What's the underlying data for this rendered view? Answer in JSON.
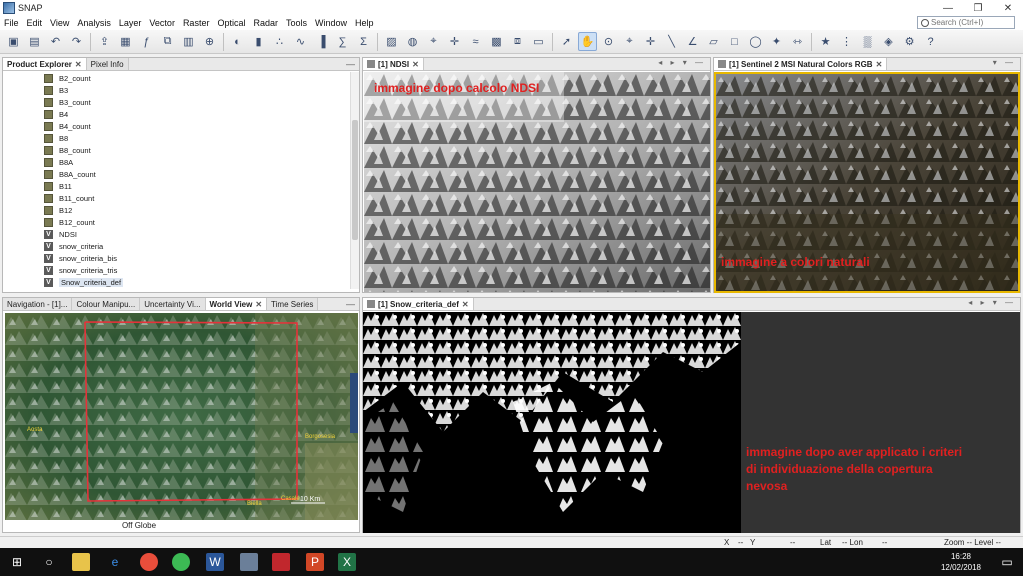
{
  "window": {
    "title": "SNAP",
    "controls": [
      "—",
      "❐",
      "✕"
    ]
  },
  "menu": [
    "File",
    "Edit",
    "View",
    "Analysis",
    "Layer",
    "Vector",
    "Raster",
    "Optical",
    "Radar",
    "Tools",
    "Window",
    "Help"
  ],
  "search": {
    "placeholder": "Search (Ctrl+I)"
  },
  "toolbar_icons": [
    "open-product-icon",
    "save-icon",
    "undo-icon",
    "redo-icon",
    "export-icon",
    "layer-icon",
    "band-maths-icon",
    "graph-builder-icon",
    "batch-icon",
    "reproject-icon",
    "colour-manip-icon",
    "chart-icon",
    "scatter-icon",
    "profile-icon",
    "histogram-icon",
    "statistics-icon",
    "sigma-icon",
    "mask-icon",
    "world-map-icon",
    "pin-icon",
    "gcp-icon",
    "spectrum-icon",
    "mosaic-icon",
    "collocation-icon",
    "subset-icon",
    "select-tool-icon",
    "pan-tool-icon",
    "zoom-tool-icon",
    "pin-tool-icon",
    "gcp-tool-icon",
    "line-tool-icon",
    "polyline-tool-icon",
    "polygon-tool-icon",
    "rectangle-tool-icon",
    "ellipse-tool-icon",
    "magic-wand-icon",
    "range-finder-icon",
    "star-icon",
    "pixel-info-icon",
    "time-series-icon",
    "hub-icon",
    "options-icon",
    "help-icon"
  ],
  "product_explorer": {
    "tabs": [
      {
        "label": "Product Explorer",
        "active": true
      },
      {
        "label": "Pixel Info",
        "active": false
      }
    ],
    "items": [
      {
        "label": "B2_count",
        "type": "band"
      },
      {
        "label": "B3",
        "type": "band"
      },
      {
        "label": "B3_count",
        "type": "band"
      },
      {
        "label": "B4",
        "type": "band"
      },
      {
        "label": "B4_count",
        "type": "band"
      },
      {
        "label": "B8",
        "type": "band"
      },
      {
        "label": "B8_count",
        "type": "band"
      },
      {
        "label": "B8A",
        "type": "band"
      },
      {
        "label": "B8A_count",
        "type": "band"
      },
      {
        "label": "B11",
        "type": "band"
      },
      {
        "label": "B11_count",
        "type": "band"
      },
      {
        "label": "B12",
        "type": "band"
      },
      {
        "label": "B12_count",
        "type": "band"
      },
      {
        "label": "NDSI",
        "type": "virtual"
      },
      {
        "label": "snow_criteria",
        "type": "virtual"
      },
      {
        "label": "snow_criteria_bis",
        "type": "virtual"
      },
      {
        "label": "snow_criteria_tris",
        "type": "virtual"
      },
      {
        "label": "Snow_criteria_def",
        "type": "virtual",
        "selected": true
      }
    ]
  },
  "navigation_panel": {
    "tabs": [
      {
        "label": "Navigation - [1]...",
        "active": false
      },
      {
        "label": "Colour Manipu...",
        "active": false
      },
      {
        "label": "Uncertainty Vi...",
        "active": false
      },
      {
        "label": "World View",
        "active": true
      },
      {
        "label": "Time Series",
        "active": false
      }
    ],
    "footer": "Off Globe",
    "map_labels": [
      "Aosta",
      "Borgosesia",
      "Biella",
      "Casale"
    ],
    "scale": "10 Km"
  },
  "views": {
    "ndsi": {
      "tab": "[1] NDSI",
      "overlay": "immagine dopo calcolo NDSI"
    },
    "rgb": {
      "tab": "[1] Sentinel 2 MSI Natural Colors RGB",
      "overlay": "immagine a colori naturali"
    },
    "snow": {
      "tab": "[1] Snow_criteria_def",
      "overlay_lines": [
        "immagine dopo aver applicato i criteri",
        "di individuazione della copertura",
        "nevosa"
      ]
    }
  },
  "statusbar": {
    "x": "X",
    "xval": "--",
    "y": "Y",
    "yval": "--",
    "lat": "Lat",
    "latval": "-- Lon",
    "lonval": "--",
    "zoom": "Zoom -- Level --"
  },
  "taskbar": {
    "time": "16:28",
    "date": "12/02/2018"
  },
  "colors": {
    "accent_red": "#e02020",
    "selected_border": "#e8b800",
    "map_box": "#e5323a"
  }
}
